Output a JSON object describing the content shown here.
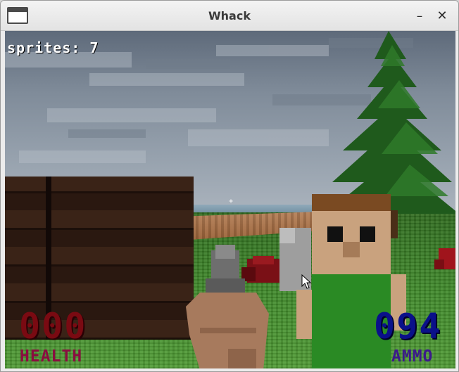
{
  "window": {
    "title": "Whack",
    "minimize_glyph": "–",
    "close_glyph": "✕"
  },
  "game": {
    "sprites_label": "sprites: 7",
    "crosshair_glyph": "+",
    "health": {
      "value": "000",
      "label": "HEALTH"
    },
    "ammo": {
      "value": "094",
      "label": "AMMO"
    }
  },
  "colors": {
    "health": "#7a0a12",
    "ammo": "#0a108a",
    "grass": "#3f8a2a",
    "sky": "#97a2ae"
  },
  "icons": {
    "app": "window-icon",
    "minimize": "minimize-icon",
    "close": "close-icon",
    "cursor": "mouse-pointer-icon"
  }
}
